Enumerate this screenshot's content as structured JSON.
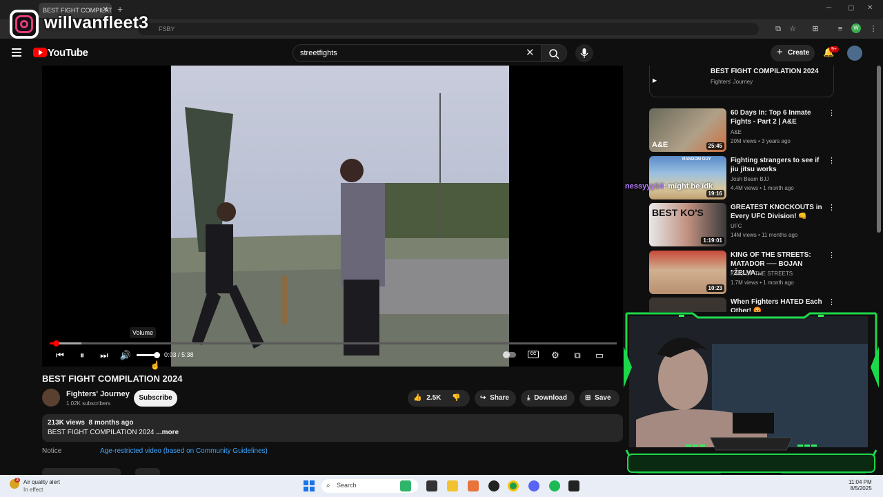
{
  "browser": {
    "tab_title": "BEST FIGHT COMPILATION 2024",
    "address_partial": "FSBY",
    "profile_initial": "W"
  },
  "overlay": {
    "instagram_handle": "willvanfleet3",
    "chat_user": "nessyyy14",
    "chat_message": ": might be idk"
  },
  "youtube": {
    "logo_text": "YouTube",
    "search_value": "streetfights",
    "create_label": "Create",
    "notif_badge": "9+"
  },
  "player": {
    "time_label": "0:03 / 5:38",
    "tooltip": "Volume",
    "cc_label": "CC",
    "progress_fraction": 0.009,
    "volume_fraction": 0.9
  },
  "video": {
    "title": "BEST FIGHT COMPILATION 2024",
    "channel_name": "Fighters' Journey",
    "subscribers": "1.02K subscribers",
    "subscribe_label": "Subscribe",
    "like_count": "2.5K",
    "share_label": "Share",
    "download_label": "Download",
    "save_label": "Save",
    "views_line": "213K views  8 months ago",
    "description": "BEST FIGHT COMPILATION 2024 ",
    "more_label": "...more",
    "notice_label": "Notice",
    "notice_link": "Age-restricted video (based on Community Guidelines)"
  },
  "sidebar": {
    "now_playing": {
      "title": "BEST FIGHT COMPILATION 2024",
      "channel": "Fighters' Journey"
    },
    "recs": [
      {
        "title": "60 Days In: Top 6 Inmate Fights - Part 2 | A&E",
        "channel": "A&E",
        "meta": "20M views • 3 years ago",
        "duration": "25:45",
        "thumb_text": "A&E"
      },
      {
        "title": "Fighting strangers to see if jiu jitsu works",
        "channel": "Josh Beam BJJ",
        "meta": "4.4M views • 1 month ago",
        "duration": "19:16",
        "thumb_text": "RANDOM GUY"
      },
      {
        "title": "GREATEST KNOCKOUTS in Every UFC Division! 👊",
        "channel": "UFC",
        "meta": "14M views • 11 months ago",
        "duration": "1:19:01",
        "thumb_text": "BEST KO'S"
      },
      {
        "title": "KING OF THE STREETS: MATADOR ── BOJAN \"ŽELVA...",
        "channel": "KING OF THE STREETS",
        "meta": "1.7M views • 1 month ago",
        "duration": "10:23",
        "thumb_text": ""
      },
      {
        "title": "When Fighters HATED Each Other! 😡",
        "channel": "",
        "meta": "",
        "duration": "",
        "thumb_text": ""
      }
    ]
  },
  "taskbar": {
    "alert_title": "Air quality alert",
    "alert_sub": "In effect",
    "alert_badge": "3",
    "search_label": "Search",
    "time": "11:04 PM",
    "date": "8/5/2025"
  }
}
